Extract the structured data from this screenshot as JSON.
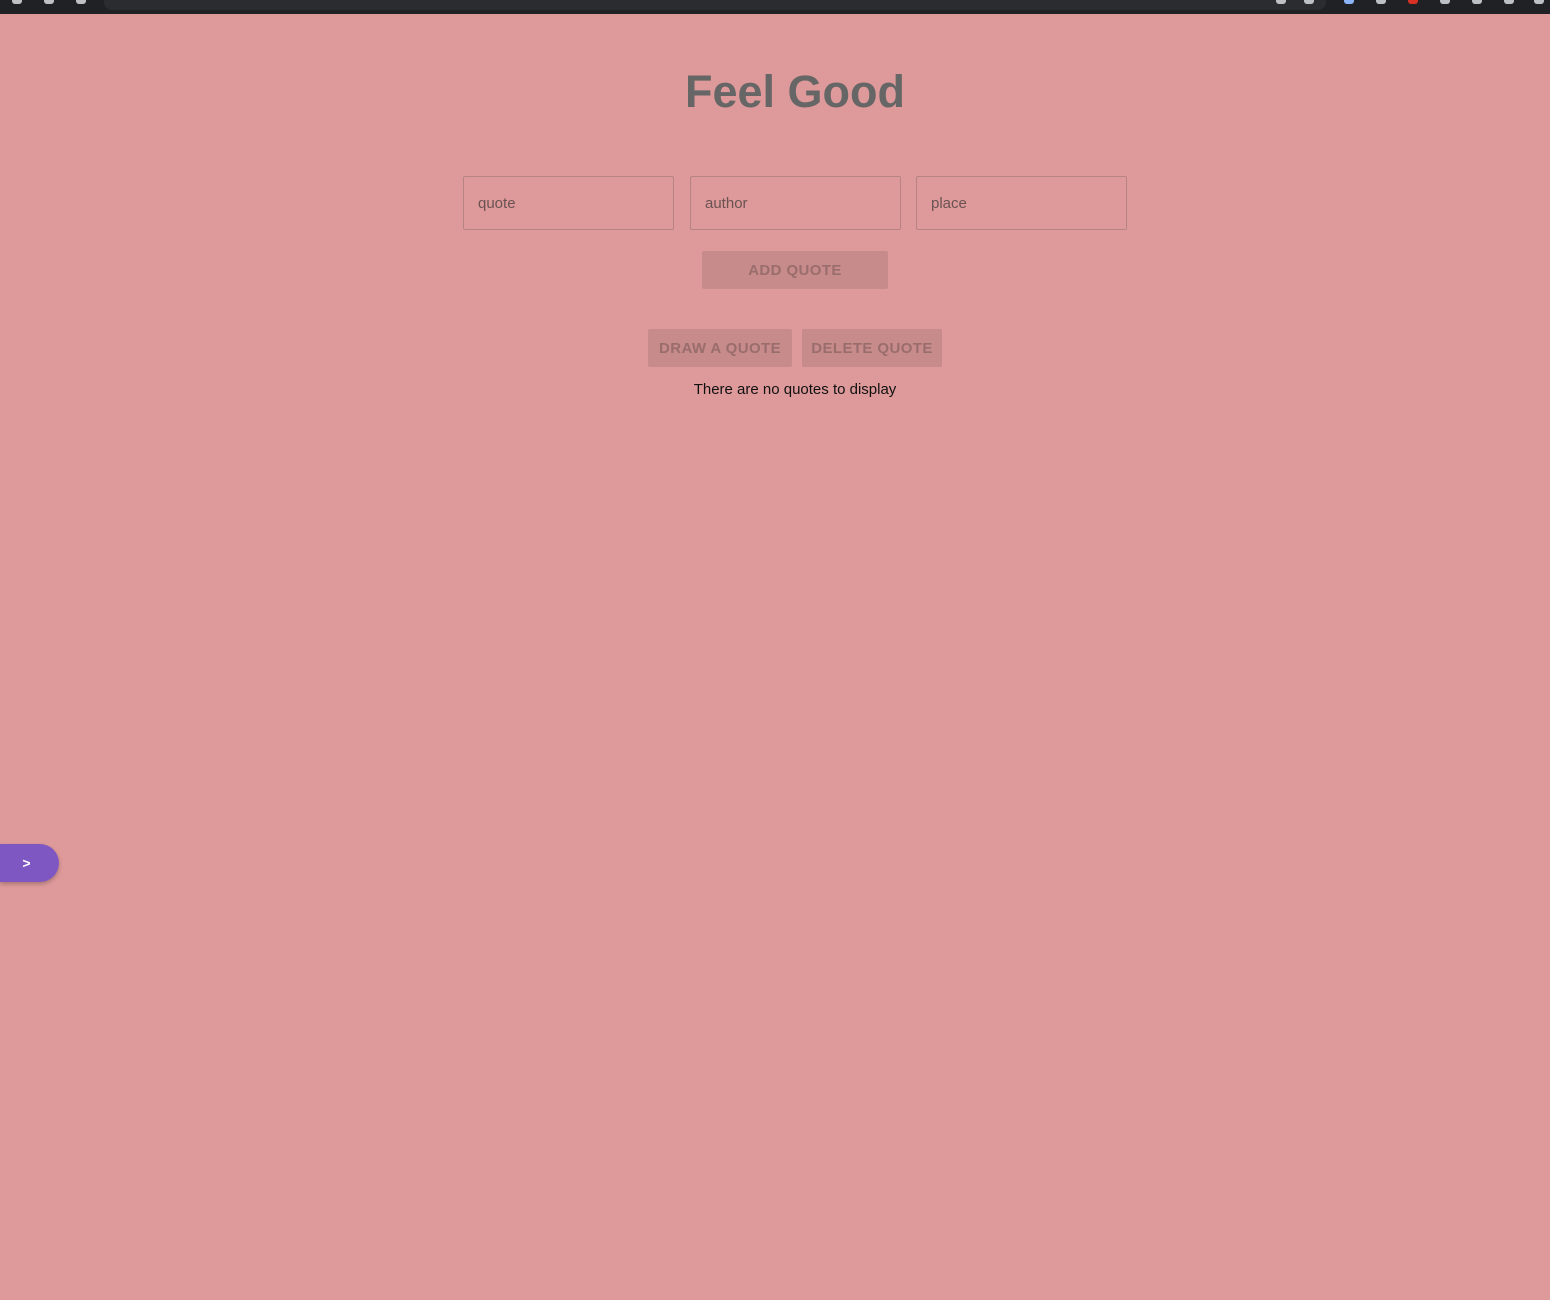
{
  "app": {
    "title": "Feel Good"
  },
  "form": {
    "quote_placeholder": "quote",
    "author_placeholder": "author",
    "place_placeholder": "place",
    "quote_value": "",
    "author_value": "",
    "place_value": "",
    "add_label": "ADD QUOTE"
  },
  "actions": {
    "draw_label": "DRAW A QUOTE",
    "delete_label": "DELETE QUOTE"
  },
  "status": {
    "empty_message": "There are no quotes to display"
  },
  "side_toggle": {
    "label": ">"
  },
  "colors": {
    "background": "#de9a9a",
    "title": "#666666",
    "button_bg": "#c88b8b",
    "button_text": "#9a6d6d",
    "toggle": "#7e57c2"
  }
}
